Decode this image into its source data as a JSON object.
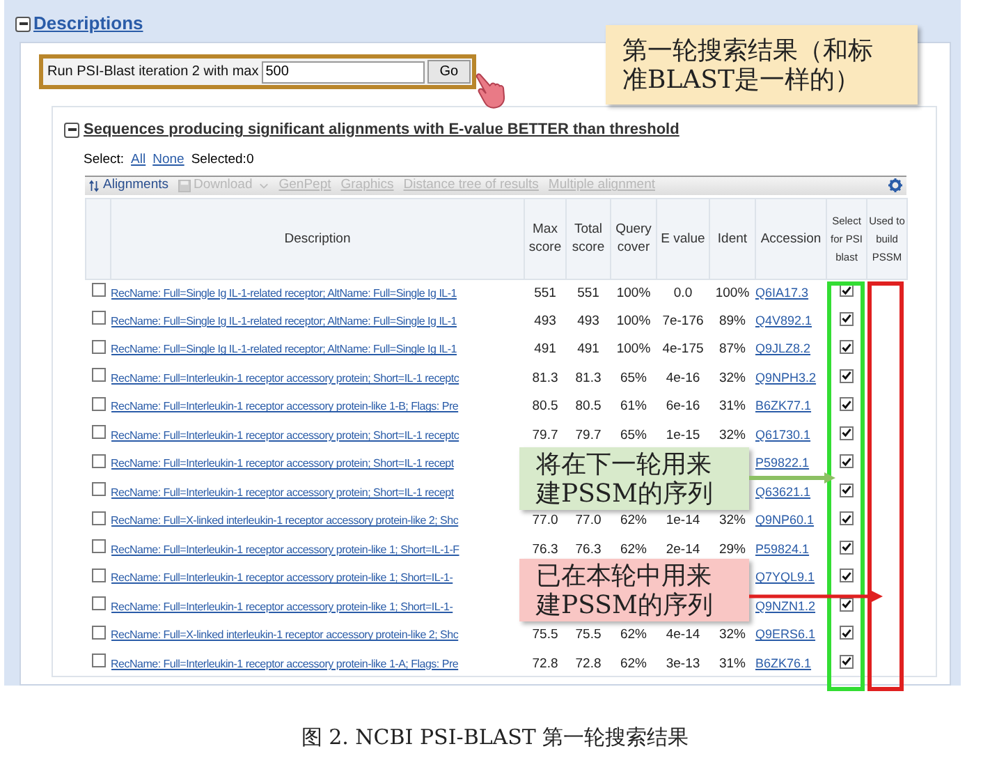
{
  "section_title": "Descriptions",
  "iteration_form": {
    "label": "Run PSI-Blast iteration 2 with max",
    "value": "500",
    "button": "Go"
  },
  "results": {
    "title": "Sequences producing significant alignments with E-value BETTER than threshold",
    "select": {
      "label": "Select:",
      "links": [
        "All",
        "None"
      ],
      "count": "Selected:0"
    },
    "toolbar": [
      {
        "kind": "view",
        "label": "Alignments",
        "disabled": false
      },
      {
        "kind": "download",
        "label": "Download",
        "disabled": true
      },
      {
        "kind": "link",
        "label": "GenPept",
        "disabled": true
      },
      {
        "kind": "link",
        "label": "Graphics",
        "disabled": true
      },
      {
        "kind": "link",
        "label": "Distance tree of results",
        "disabled": true
      },
      {
        "kind": "link",
        "label": "Multiple alignment",
        "disabled": true
      }
    ],
    "columns": [
      "Description",
      "Max score",
      "Total score",
      "Query cover",
      "E value",
      "Ident",
      "Accession",
      "Select for PSI blast",
      "Used to build PSSM"
    ],
    "rows": [
      {
        "description": "RecName: Full=Single Ig IL-1-related receptor; AltName: Full=Single Ig IL-1",
        "max_score": "551",
        "total_score": "551",
        "query_cover": "100%",
        "e_value": "0.0",
        "ident": "100%",
        "accession": "Q6IA17.3",
        "selected": false,
        "select_for_psi": true,
        "used_for_pssm": false
      },
      {
        "description": "RecName: Full=Single Ig IL-1-related receptor; AltName: Full=Single Ig IL-1",
        "max_score": "493",
        "total_score": "493",
        "query_cover": "100%",
        "e_value": "7e-176",
        "ident": "89%",
        "accession": "Q4V892.1",
        "selected": false,
        "select_for_psi": true,
        "used_for_pssm": false
      },
      {
        "description": "RecName: Full=Single Ig IL-1-related receptor; AltName: Full=Single Ig IL-1",
        "max_score": "491",
        "total_score": "491",
        "query_cover": "100%",
        "e_value": "4e-175",
        "ident": "87%",
        "accession": "Q9JLZ8.2",
        "selected": false,
        "select_for_psi": true,
        "used_for_pssm": false
      },
      {
        "description": "RecName: Full=Interleukin-1 receptor accessory protein; Short=IL-1 receptc",
        "max_score": "81.3",
        "total_score": "81.3",
        "query_cover": "65%",
        "e_value": "4e-16",
        "ident": "32%",
        "accession": "Q9NPH3.2",
        "selected": false,
        "select_for_psi": true,
        "used_for_pssm": false
      },
      {
        "description": "RecName: Full=Interleukin-1 receptor accessory protein-like 1-B; Flags: Pre",
        "max_score": "80.5",
        "total_score": "80.5",
        "query_cover": "61%",
        "e_value": "6e-16",
        "ident": "31%",
        "accession": "B6ZK77.1",
        "selected": false,
        "select_for_psi": true,
        "used_for_pssm": false
      },
      {
        "description": "RecName: Full=Interleukin-1 receptor accessory protein; Short=IL-1 receptc",
        "max_score": "79.7",
        "total_score": "79.7",
        "query_cover": "65%",
        "e_value": "1e-15",
        "ident": "32%",
        "accession": "Q61730.1",
        "selected": false,
        "select_for_psi": true,
        "used_for_pssm": false
      },
      {
        "description": "RecName: Full=Interleukin-1 receptor accessory protein; Short=IL-1 recept",
        "accession": "P59822.1",
        "selected": false,
        "select_for_psi": true,
        "used_for_pssm": false
      },
      {
        "description": "RecName: Full=Interleukin-1 receptor accessory protein; Short=IL-1 recept",
        "accession": "Q63621.1",
        "selected": false,
        "select_for_psi": true,
        "used_for_pssm": false
      },
      {
        "description": "RecName: Full=X-linked interleukin-1 receptor accessory protein-like 2; Shc",
        "max_score": "77.0",
        "total_score": "77.0",
        "query_cover": "62%",
        "e_value": "1e-14",
        "ident": "32%",
        "accession": "Q9NP60.1",
        "selected": false,
        "select_for_psi": true,
        "used_for_pssm": false
      },
      {
        "description": "RecName: Full=Interleukin-1 receptor accessory protein-like 1; Short=IL-1-F",
        "max_score": "76.3",
        "total_score": "76.3",
        "query_cover": "62%",
        "e_value": "2e-14",
        "ident": "29%",
        "accession": "P59824.1",
        "selected": false,
        "select_for_psi": true,
        "used_for_pssm": false
      },
      {
        "description": "RecName: Full=Interleukin-1 receptor accessory protein-like 1; Short=IL-1-",
        "accession": "Q7YQL9.1",
        "selected": false,
        "select_for_psi": true,
        "used_for_pssm": false
      },
      {
        "description": "RecName: Full=Interleukin-1 receptor accessory protein-like 1; Short=IL-1-",
        "accession": "Q9NZN1.2",
        "selected": false,
        "select_for_psi": true,
        "used_for_pssm": false
      },
      {
        "description": "RecName: Full=X-linked interleukin-1 receptor accessory protein-like 2; Shc",
        "max_score": "75.5",
        "total_score": "75.5",
        "query_cover": "62%",
        "e_value": "4e-14",
        "ident": "32%",
        "accession": "Q9ERS6.1",
        "selected": false,
        "select_for_psi": true,
        "used_for_pssm": false
      },
      {
        "description": "RecName: Full=Interleukin-1 receptor accessory protein-like 1-A; Flags: Pre",
        "max_score": "72.8",
        "total_score": "72.8",
        "query_cover": "62%",
        "e_value": "3e-13",
        "ident": "31%",
        "accession": "B6ZK76.1",
        "selected": false,
        "select_for_psi": true,
        "used_for_pssm": false
      }
    ]
  },
  "callouts": [
    {
      "kind": "note",
      "text": "第一轮搜索结果（和标准BLAST是一样的）"
    },
    {
      "kind": "next_round",
      "text": "将在下一轮用来建PSSM的序列"
    },
    {
      "kind": "this_round",
      "text": "已在本轮中用来建PSSM的序列"
    }
  ],
  "caption": "图 2. NCBI PSI-BLAST 第一轮搜索结果"
}
